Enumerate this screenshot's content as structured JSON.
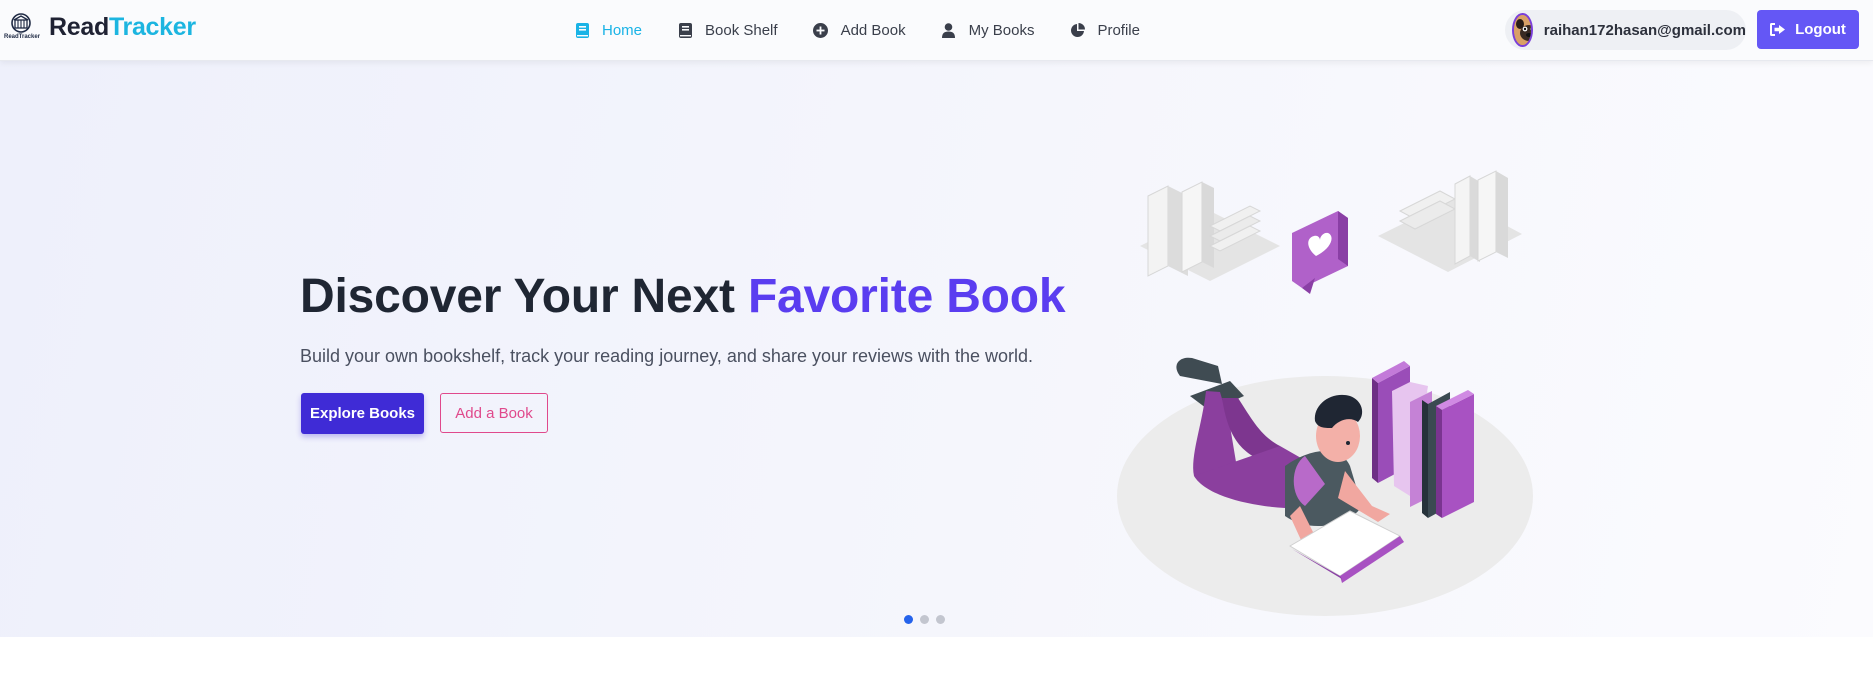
{
  "brand": {
    "logo_caption": "ReadTracker",
    "name_part1": "Read",
    "name_part2": "Tracker"
  },
  "nav": {
    "items": [
      {
        "label": "Home",
        "icon": "book-icon",
        "active": true
      },
      {
        "label": "Book Shelf",
        "icon": "book-shelf-icon",
        "active": false
      },
      {
        "label": "Add Book",
        "icon": "plus-circle-icon",
        "active": false
      },
      {
        "label": "My Books",
        "icon": "user-icon",
        "active": false
      },
      {
        "label": "Profile",
        "icon": "chart-pie-icon",
        "active": false
      }
    ]
  },
  "user": {
    "email": "raihan172hasan@gmail.com",
    "avatar_icon": "pug-avatar"
  },
  "logout": {
    "label": "Logout",
    "icon": "sign-out-icon"
  },
  "hero": {
    "title_part1": "Discover Your Next ",
    "title_accent": "Favorite Book",
    "subtitle": "Build your own bookshelf, track your reading journey, and share your reviews with the world.",
    "primary_button": "Explore Books",
    "secondary_button": "Add a Book",
    "illustration": "person-reading-books-illustration"
  },
  "carousel": {
    "slides": 3,
    "active_index": 0
  },
  "colors": {
    "brand_accent": "#1cb5e0",
    "primary": "#3f2bd6",
    "title_accent": "#5a3df0",
    "logout": "#6457f5",
    "outline_pink": "#e0498c",
    "dot_active": "#2563eb"
  }
}
